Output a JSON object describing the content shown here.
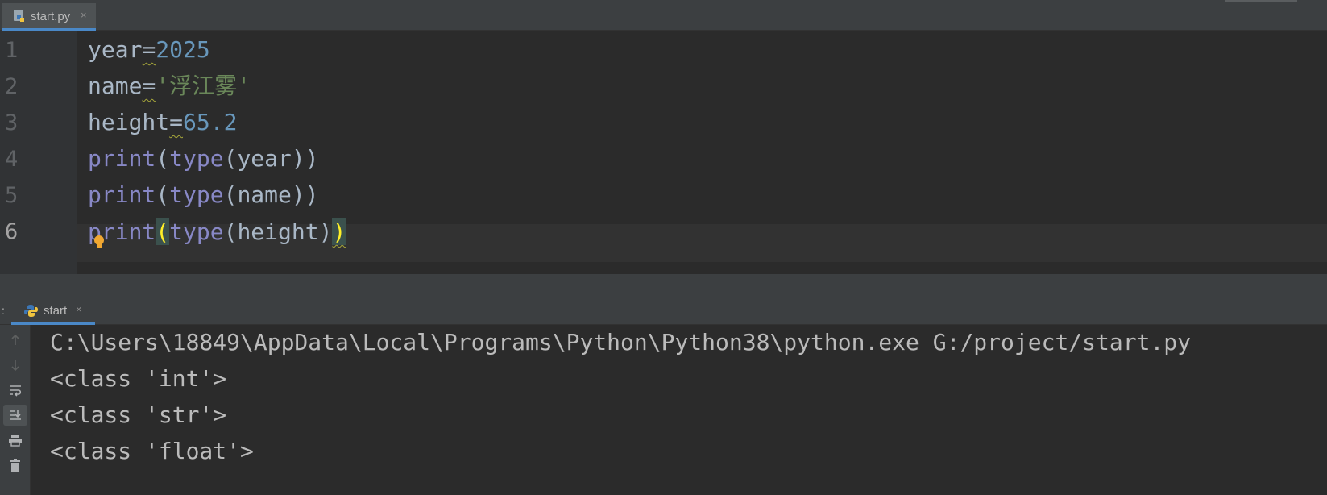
{
  "editor_tab": {
    "label": "start.py",
    "close": "×"
  },
  "code_lines": [
    {
      "num": "1",
      "tokens": [
        {
          "t": "year",
          "c": "plain"
        },
        {
          "t": "=",
          "c": "plain weak"
        },
        {
          "t": "2025",
          "c": "num"
        }
      ]
    },
    {
      "num": "2",
      "tokens": [
        {
          "t": "name",
          "c": "plain"
        },
        {
          "t": "=",
          "c": "plain weak"
        },
        {
          "t": "'浮江雾'",
          "c": "str"
        }
      ]
    },
    {
      "num": "3",
      "tokens": [
        {
          "t": "height",
          "c": "plain"
        },
        {
          "t": "=",
          "c": "plain weak"
        },
        {
          "t": "65.2",
          "c": "num"
        }
      ]
    },
    {
      "num": "4",
      "tokens": [
        {
          "t": "print",
          "c": "kw"
        },
        {
          "t": "(",
          "c": "plain"
        },
        {
          "t": "type",
          "c": "kw"
        },
        {
          "t": "(year))",
          "c": "plain"
        }
      ]
    },
    {
      "num": "5",
      "tokens": [
        {
          "t": "print",
          "c": "kw"
        },
        {
          "t": "(",
          "c": "plain"
        },
        {
          "t": "type",
          "c": "kw"
        },
        {
          "t": "(name))",
          "c": "plain"
        }
      ]
    },
    {
      "num": "6",
      "tokens": [
        {
          "t": "print",
          "c": "kw"
        },
        {
          "t": "(",
          "c": "brace-hl"
        },
        {
          "t": "type",
          "c": "kw"
        },
        {
          "t": "(height)",
          "c": "plain"
        },
        {
          "t": ")",
          "c": "brace-hl weak"
        }
      ]
    }
  ],
  "run_panel": {
    "prefix": ":",
    "tab_label": "start",
    "close": "×",
    "output_lines": [
      "C:\\Users\\18849\\AppData\\Local\\Programs\\Python\\Python38\\python.exe G:/project/start.py",
      "<class 'int'>",
      "<class 'str'>",
      "<class 'float'>"
    ],
    "toolbar_icons": [
      "arrow-up-icon",
      "arrow-down-icon",
      "soft-wrap-icon",
      "scroll-to-end-icon",
      "print-icon",
      "trash-icon"
    ]
  },
  "colors": {
    "keyword": "#8888c6",
    "number": "#6897bb",
    "string": "#6a8759",
    "brace_highlight": "#ffef28",
    "tab_underline": "#4a88c7"
  }
}
